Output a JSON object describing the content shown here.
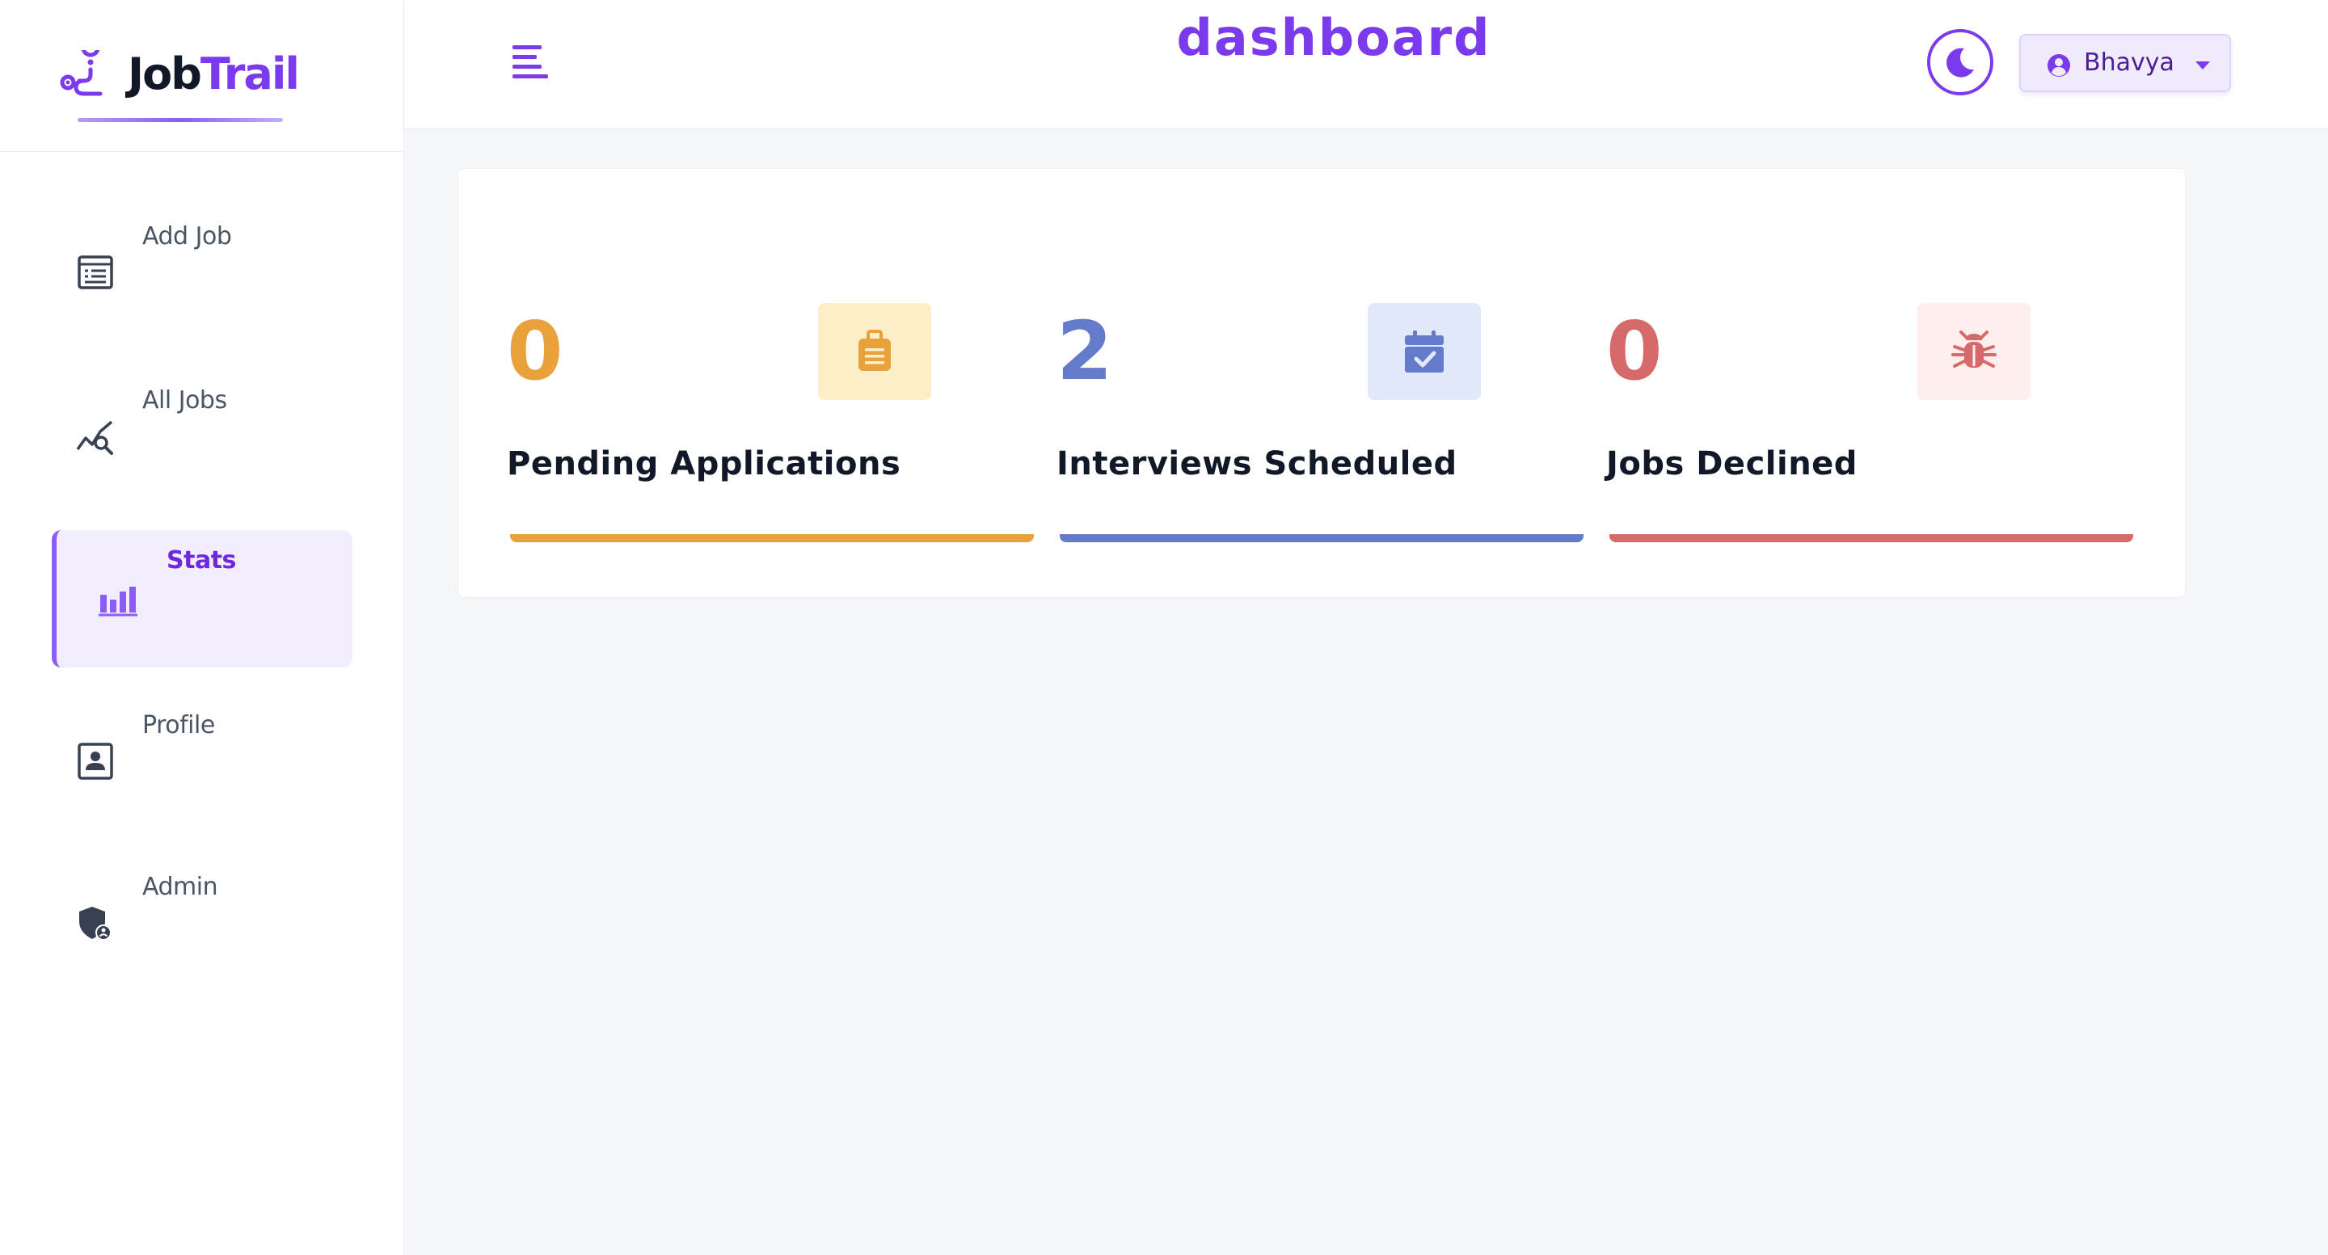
{
  "app": {
    "logo_part1": "Job",
    "logo_part2": "Trail"
  },
  "header": {
    "title": "dashboard",
    "user_name": "Bhavya"
  },
  "sidebar": {
    "items": [
      {
        "label": "Add Job",
        "icon": "add-job-icon"
      },
      {
        "label": "All Jobs",
        "icon": "all-jobs-icon"
      },
      {
        "label": "Stats",
        "icon": "stats-icon",
        "active": true
      },
      {
        "label": "Profile",
        "icon": "profile-icon"
      },
      {
        "label": "Admin",
        "icon": "admin-icon"
      }
    ]
  },
  "stats": [
    {
      "count": "0",
      "label": "Pending Applications",
      "color": "#e9a23b",
      "bg": "#fcefc7",
      "icon": "suitcase-icon"
    },
    {
      "count": "2",
      "label": "Interviews Scheduled",
      "color": "#647acb",
      "bg": "#e0e8f9",
      "icon": "calendar-check-icon"
    },
    {
      "count": "0",
      "label": "Jobs Declined",
      "color": "#d66a6a",
      "bg": "#ffeeee",
      "icon": "bug-icon"
    }
  ],
  "colors": {
    "accent": "#7c3aed"
  }
}
